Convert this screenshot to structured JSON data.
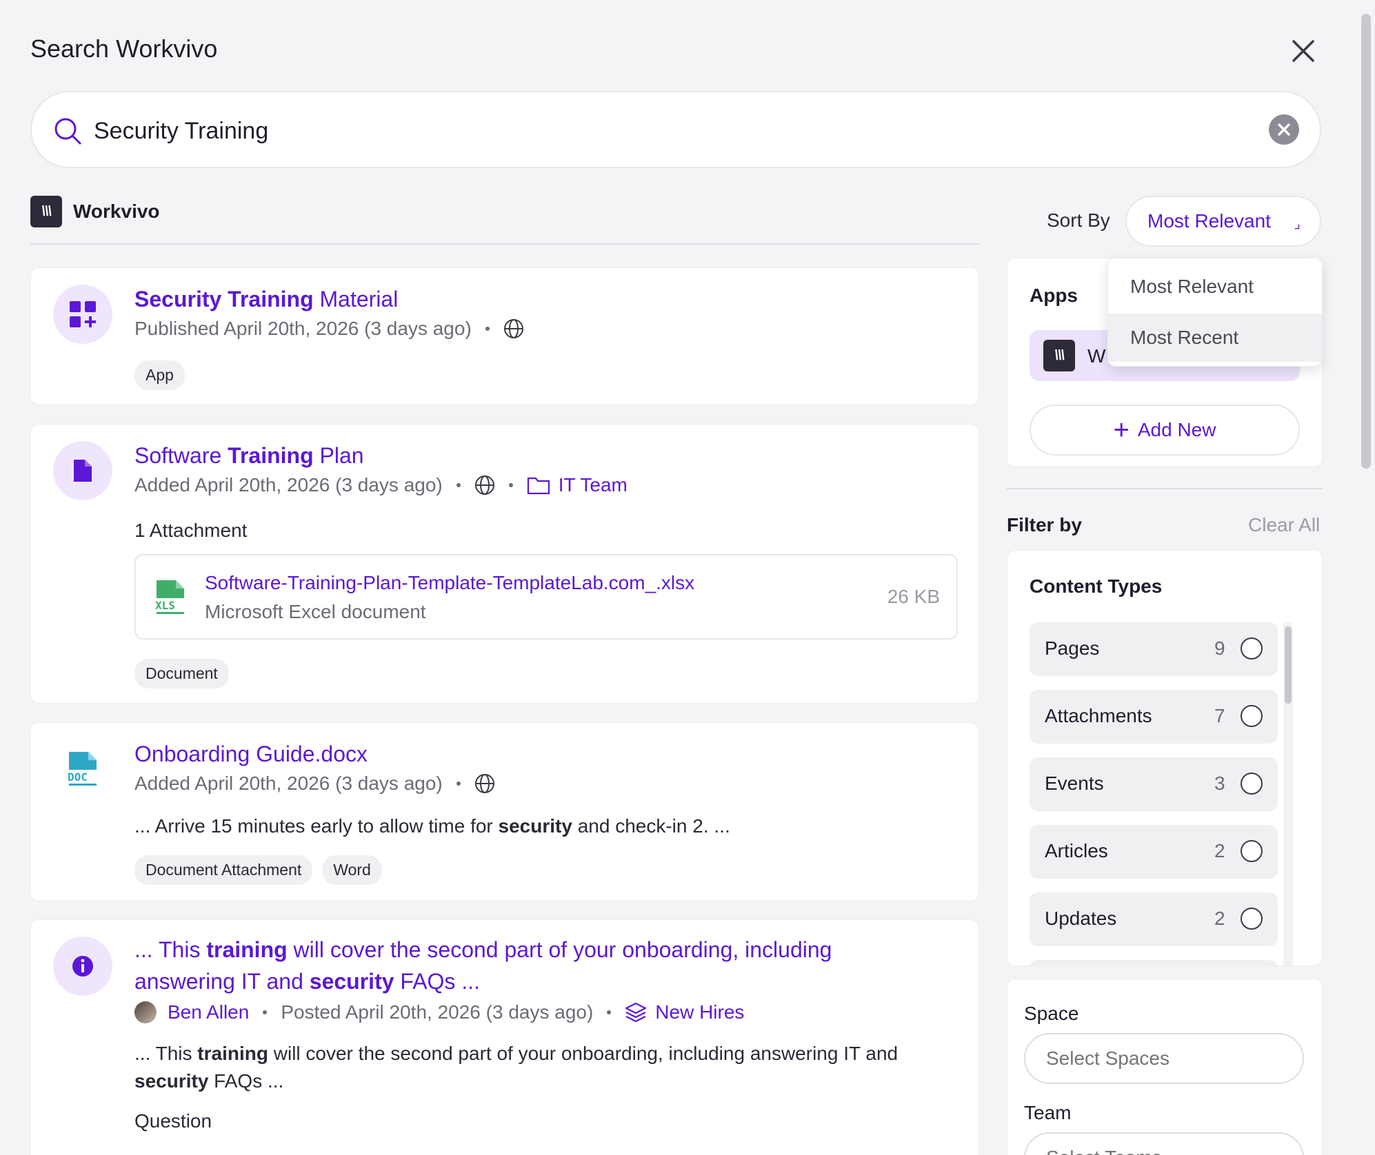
{
  "header": {
    "title": "Search Workvivo"
  },
  "search": {
    "value": "Security Training"
  },
  "source_tab": {
    "label": "Workvivo"
  },
  "sort": {
    "label": "Sort By",
    "selected": "Most Relevant",
    "options": [
      "Most Relevant",
      "Most Recent"
    ]
  },
  "results": [
    {
      "title_parts": [
        "Security",
        " ",
        "Training",
        " Material"
      ],
      "meta": "Published April 20th, 2026 (3 days ago)",
      "tags": [
        "App"
      ]
    },
    {
      "title_parts": [
        "Software ",
        "Training",
        " Plan"
      ],
      "meta": "Added April 20th, 2026 (3 days ago)",
      "space": "IT Team",
      "attachments_label": "1 Attachment",
      "attachment": {
        "name": "Software-Training-Plan-Template-TemplateLab.com_.xlsx",
        "type": "Microsoft Excel document",
        "size": "26 KB"
      },
      "tags": [
        "Document"
      ]
    },
    {
      "title": "Onboarding Guide.docx",
      "meta": "Added April 20th, 2026 (3 days ago)",
      "snippet_parts": [
        "... Arrive 15 minutes early to allow time for ",
        "security",
        " and check-in 2. ..."
      ],
      "tags": [
        "Document Attachment",
        "Word"
      ]
    },
    {
      "title_parts": [
        "... This ",
        "training",
        " will cover the second part of your onboarding, including answering IT and ",
        "security",
        " FAQs ..."
      ],
      "author": "Ben Allen",
      "meta": "Posted April 20th, 2026 (3 days ago)",
      "space": "New Hires",
      "snippet_parts": [
        "... This ",
        "training",
        " will cover the second part of your onboarding, including answering IT and ",
        "security",
        " FAQs ..."
      ],
      "section_label": "Question"
    }
  ],
  "apps_panel": {
    "title": "Apps",
    "app_name": "Workvivo",
    "app_name_visible": "W",
    "add_new": "Add New"
  },
  "filter": {
    "title": "Filter by",
    "clear_all": "Clear All",
    "content_types_title": "Content Types",
    "content_types": [
      {
        "label": "Pages",
        "count": "9"
      },
      {
        "label": "Attachments",
        "count": "7"
      },
      {
        "label": "Events",
        "count": "3"
      },
      {
        "label": "Articles",
        "count": "2"
      },
      {
        "label": "Updates",
        "count": "2"
      }
    ],
    "space_label": "Space",
    "space_placeholder": "Select Spaces",
    "team_label": "Team",
    "team_placeholder": "Select Teams"
  },
  "colors": {
    "accent": "#5b17d6",
    "accent_soft": "#efe6fd",
    "page_bg": "#f4f4f6"
  }
}
